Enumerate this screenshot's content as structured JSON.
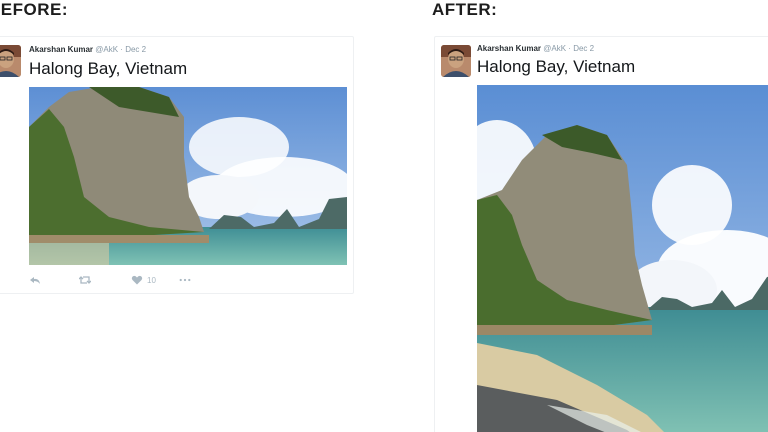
{
  "before": {
    "heading": "BEFORE:",
    "tweet": {
      "author_name": "Akarshan Kumar",
      "handle": "@AkK",
      "separator": "·",
      "date": "Dec 2",
      "text": "Halong Bay, Vietnam",
      "like_count": "10"
    }
  },
  "after": {
    "heading": "AFTER:",
    "tweet": {
      "author_name": "Akarshan Kumar",
      "handle": "@AkK",
      "separator": "·",
      "date": "Dec 2",
      "text": "Halong Bay, Vietnam"
    }
  },
  "icons": {
    "reply": "reply-icon",
    "retweet": "retweet-icon",
    "like": "heart-icon",
    "more": "more-icon"
  },
  "colors": {
    "text": "#14171a",
    "muted": "#8899a6",
    "action": "#aab8c2",
    "sky": "#6a9ad6",
    "sea": "#4fa3a0"
  }
}
